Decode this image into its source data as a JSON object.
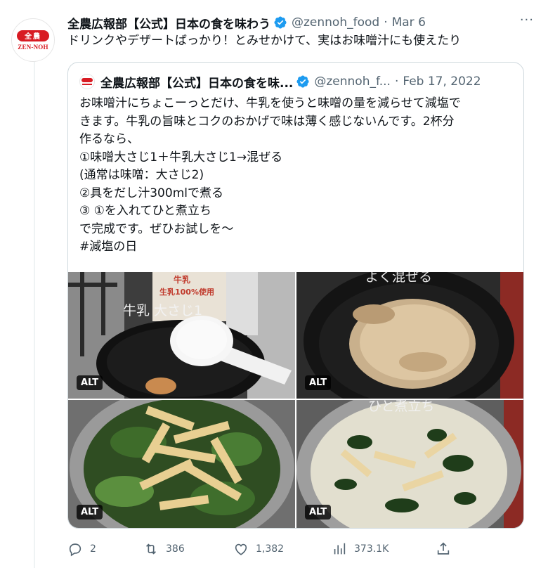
{
  "tweet": {
    "author_name": "全農広報部【公式】日本の食を味わう",
    "handle": "@zennoh_food",
    "separator": "·",
    "date": "Mar 6",
    "more": "···",
    "text": "ドリンクやデザートばっかり！とみせかけて、実はお味噌汁にも使えたり",
    "avatar_mark": "全農",
    "avatar_text": "ZEN-NOH"
  },
  "quote": {
    "author_name": "全農広報部【公式】日本の食を味...",
    "handle": "@zennoh_f...",
    "separator": "·",
    "date": "Feb 17, 2022",
    "lines": [
      "お味噌汁にちょこーっとだけ、牛乳を使うと味噌の量を減らせて減塩で",
      "きます。牛乳の旨味とコクのおかげで味は薄く感じないんです。2杯分",
      "作るなら、",
      "①味噌大さじ1＋牛乳大さじ1→混ぜる",
      "(通常は味噌：大さじ2)",
      "②具をだし汁300mlで煮る",
      "③ ①を入れてひと煮立ち",
      "で完成です。ぜひお試しを〜",
      "#減塩の日"
    ],
    "photos": [
      {
        "caption": "牛乳 大さじ1",
        "carton_text_1": "牛乳",
        "carton_text_2": "生乳100%使用",
        "alt": "ALT"
      },
      {
        "caption": "よく混ぜる",
        "alt": "ALT"
      },
      {
        "caption": "",
        "alt": "ALT"
      },
      {
        "caption": "ひと煮立ち",
        "alt": "ALT"
      }
    ]
  },
  "actions": {
    "replies": "2",
    "retweets": "386",
    "likes": "1,382",
    "views": "373.1K"
  },
  "colors": {
    "verified": "#1d9bf0",
    "brand_red": "#d81b23",
    "muted": "#536471",
    "border": "#cfd9de"
  }
}
